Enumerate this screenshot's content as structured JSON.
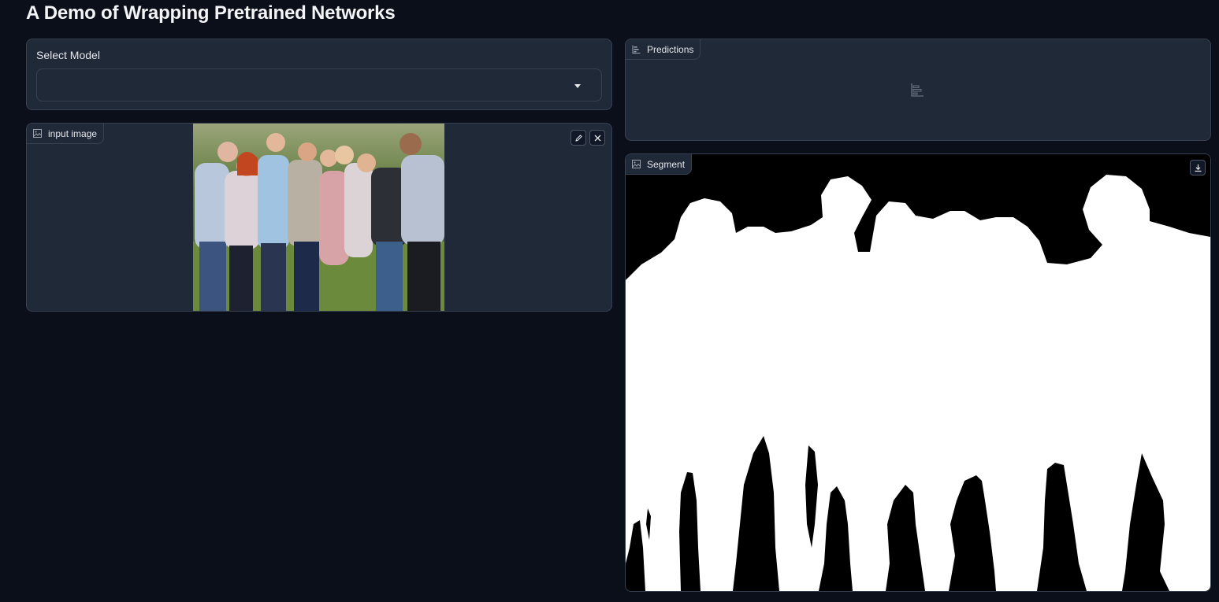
{
  "page": {
    "title": "A Demo of Wrapping Pretrained Networks"
  },
  "model_select": {
    "label": "Select Model",
    "value": ""
  },
  "input_image": {
    "label": "input image",
    "icon": "image-icon",
    "actions": [
      "edit-icon",
      "clear-icon"
    ]
  },
  "predictions": {
    "label": "Predictions",
    "icon": "bar-chart-icon",
    "placeholder_icon": "bar-chart-icon"
  },
  "segment": {
    "label": "Segment",
    "icon": "image-icon",
    "actions": [
      "download-icon"
    ]
  },
  "colors": {
    "background": "#0b0f19",
    "panel": "#1f2937",
    "border": "#374151",
    "mask_fg": "#ffffff",
    "mask_bg": "#000000"
  }
}
